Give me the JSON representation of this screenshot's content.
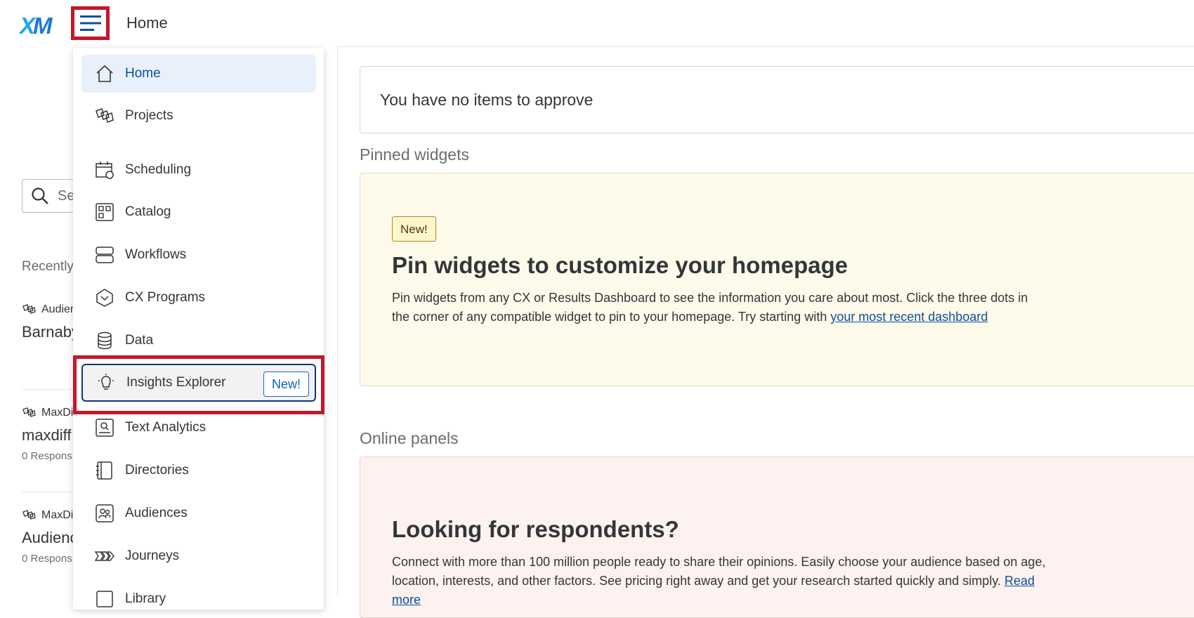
{
  "header": {
    "logo_x": "X",
    "logo_m": "M",
    "title": "Home"
  },
  "left": {
    "search_placeholder": "Se",
    "recently_label": "Recently",
    "recents": [
      {
        "type": "Audien",
        "name": "Barnaby",
        "responses": ""
      },
      {
        "type": "MaxDi",
        "name": "maxdiff",
        "responses": "0 Respons"
      },
      {
        "type": "MaxDi",
        "name": "Audienc",
        "responses": "0 Respons"
      }
    ]
  },
  "main": {
    "approve_text": "You have no items to approve",
    "pinned_title": "Pinned widgets",
    "pin_card": {
      "tag": "New!",
      "title": "Pin widgets to customize your homepage",
      "body": "Pin widgets from any CX or Results Dashboard to see the information you care about most. Click the three dots in the corner of any compatible widget to pin to your homepage. Try starting with ",
      "link": "your most recent dashboard"
    },
    "panels_title": "Online panels",
    "panel_card": {
      "title": "Looking for respondents?",
      "body": "Connect with more than 100 million people ready to share their opinions. Easily choose your audience based on age, location, interests, and other factors. See pricing right away and get your research started quickly and simply. ",
      "link": "Read more"
    }
  },
  "nav": {
    "items": [
      {
        "label": "Home",
        "icon": "home-icon"
      },
      {
        "label": "Projects",
        "icon": "projects-icon"
      },
      {
        "label": "Scheduling",
        "icon": "calendar-icon"
      },
      {
        "label": "Catalog",
        "icon": "catalog-icon"
      },
      {
        "label": "Workflows",
        "icon": "workflows-icon"
      },
      {
        "label": "CX Programs",
        "icon": "cx-programs-icon"
      },
      {
        "label": "Data",
        "icon": "database-icon"
      },
      {
        "label": "Insights Explorer",
        "icon": "lightbulb-icon",
        "badge": "New!"
      },
      {
        "label": "Text Analytics",
        "icon": "text-analytics-icon"
      },
      {
        "label": "Directories",
        "icon": "directory-icon"
      },
      {
        "label": "Audiences",
        "icon": "audiences-icon"
      },
      {
        "label": "Journeys",
        "icon": "journeys-icon"
      },
      {
        "label": "Library",
        "icon": "library-icon"
      }
    ]
  },
  "colors": {
    "accent": "#0b4f9e",
    "highlight": "#c2182b",
    "pin_bg": "#fefaea",
    "panel_bg": "#fdf2ef"
  }
}
